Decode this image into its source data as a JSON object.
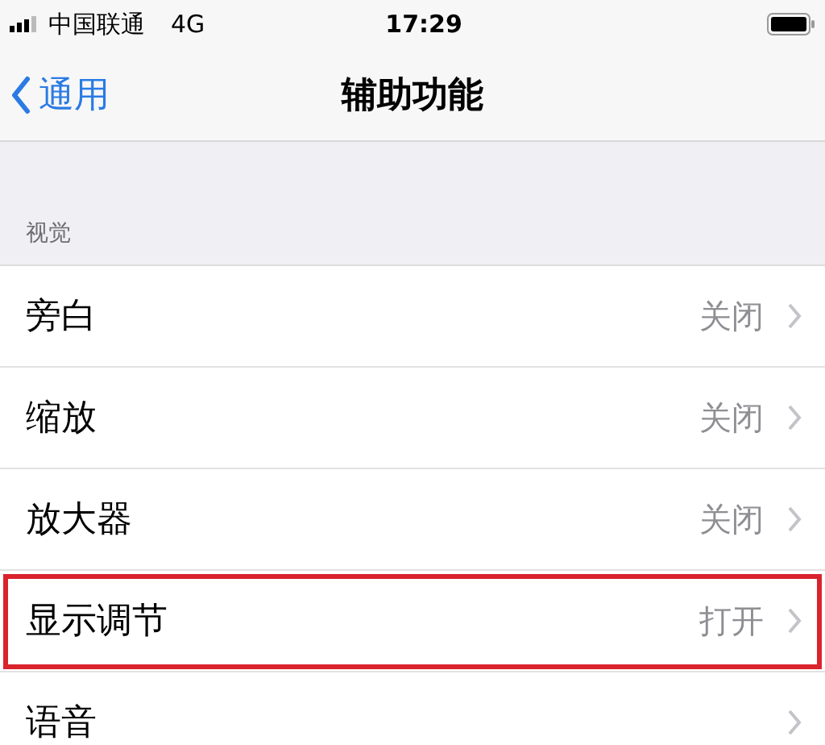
{
  "status_bar": {
    "carrier": "中国联通",
    "network": "4G",
    "time": "17:29"
  },
  "nav": {
    "back": "通用",
    "title": "辅助功能"
  },
  "section": {
    "header": "视觉"
  },
  "rows": [
    {
      "label": "旁白",
      "value": "关闭",
      "highlighted": false
    },
    {
      "label": "缩放",
      "value": "关闭",
      "highlighted": false
    },
    {
      "label": "放大器",
      "value": "关闭",
      "highlighted": false
    },
    {
      "label": "显示调节",
      "value": "打开",
      "highlighted": true
    },
    {
      "label": "语音",
      "highlighted": false
    }
  ]
}
